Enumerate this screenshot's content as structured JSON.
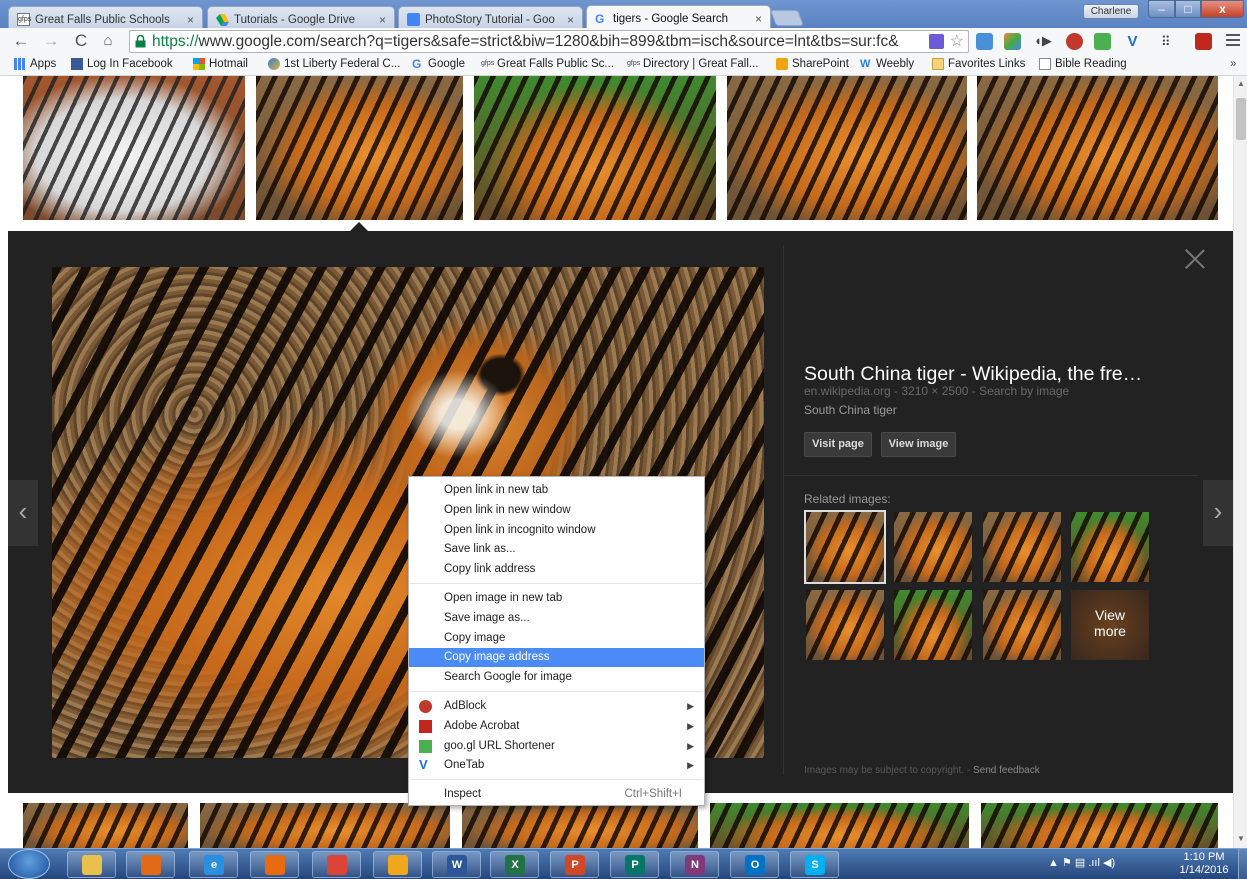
{
  "browser": {
    "tabs": [
      {
        "label": "Great Falls Public Schools",
        "close": "×",
        "favicon": "gfps-icon",
        "active": false
      },
      {
        "label": "Tutorials - Google Drive",
        "close": "×",
        "favicon": "google-drive-icon",
        "active": false
      },
      {
        "label": "PhotoStory Tutorial - Goo",
        "close": "×",
        "favicon": "google-docs-icon",
        "active": false
      },
      {
        "label": "tigers - Google Search",
        "close": "×",
        "favicon": "google-icon",
        "active": true
      }
    ],
    "user_name": "Charlene",
    "window_buttons": {
      "minimize": "–",
      "maximize": "□",
      "close": "x"
    },
    "url": {
      "scheme": "https://",
      "rest": "www.google.com/search?q=tigers&safe=strict&biw=1280&bih=899&tbm=isch&source=lnt&tbs=sur:fc&"
    },
    "bookmarks": [
      {
        "label": "Apps",
        "icon": "apps-grid-icon"
      },
      {
        "label": "Log In Facebook",
        "icon": "facebook-icon"
      },
      {
        "label": "Hotmail",
        "icon": "windows-logo-icon"
      },
      {
        "label": "1st Liberty Federal C...",
        "icon": "liberty-icon"
      },
      {
        "label": "Google",
        "icon": "google-icon"
      },
      {
        "label": "Great Falls Public Sc...",
        "icon": "gfps-icon"
      },
      {
        "label": "Directory | Great Fall...",
        "icon": "gfps-icon"
      },
      {
        "label": "SharePoint",
        "icon": "sharepoint-icon"
      },
      {
        "label": "Weebly",
        "icon": "weebly-icon"
      },
      {
        "label": "Favorites Links",
        "icon": "folder-icon"
      },
      {
        "label": "Bible Reading",
        "icon": "page-icon"
      }
    ],
    "bookmarks_more": "»"
  },
  "detail": {
    "title": "South China tiger - Wikipedia, the fre…",
    "meta": "en.wikipedia.org - 3210 × 2500 - Search by image",
    "description": "South China tiger",
    "visit_label": "Visit page",
    "view_label": "View image",
    "related_label": "Related images:",
    "view_more_label": "View\nmore",
    "copyright_text": "Images may be subject to copyright.",
    "copyright_sep": " - ",
    "feedback_label": "Send feedback"
  },
  "context_menu": {
    "group1": [
      "Open link in new tab",
      "Open link in new window",
      "Open link in incognito window",
      "Save link as...",
      "Copy link address"
    ],
    "group2": [
      "Open image in new tab",
      "Save image as...",
      "Copy image",
      "Copy image address",
      "Search Google for image"
    ],
    "highlighted": "Copy image address",
    "extensions": [
      {
        "label": "AdBlock",
        "icon": "adblock-icon",
        "color": "#c0392b"
      },
      {
        "label": "Adobe Acrobat",
        "icon": "acrobat-icon",
        "color": "#c0271d"
      },
      {
        "label": "goo.gl URL Shortener",
        "icon": "googl-shortener-icon",
        "color": "#4caf50"
      },
      {
        "label": "OneTab",
        "icon": "onetab-icon",
        "color": "#1e6fd0"
      }
    ],
    "submenu_arrow": "▶",
    "inspect_label": "Inspect",
    "inspect_shortcut": "Ctrl+Shift+I"
  },
  "taskbar": {
    "apps": [
      {
        "name": "file-explorer-icon",
        "letter": "",
        "color": "#e8c04b"
      },
      {
        "name": "media-player-icon",
        "letter": "",
        "color": "#e06a16"
      },
      {
        "name": "internet-explorer-icon",
        "letter": "e",
        "color": "#2b8fe0"
      },
      {
        "name": "firefox-icon",
        "letter": "",
        "color": "#e86b12"
      },
      {
        "name": "chrome-icon",
        "letter": "",
        "color": "#db4437"
      },
      {
        "name": "windows-apps-icon",
        "letter": "",
        "color": "#f2a81d"
      },
      {
        "name": "word-icon",
        "letter": "W",
        "color": "#2b579a"
      },
      {
        "name": "excel-icon",
        "letter": "X",
        "color": "#217346"
      },
      {
        "name": "powerpoint-icon",
        "letter": "P",
        "color": "#d24726"
      },
      {
        "name": "publisher-icon",
        "letter": "P",
        "color": "#077568"
      },
      {
        "name": "onenote-icon",
        "letter": "N",
        "color": "#80397b"
      },
      {
        "name": "outlook-icon",
        "letter": "O",
        "color": "#0072c6"
      },
      {
        "name": "skype-icon",
        "letter": "S",
        "color": "#00aff0"
      }
    ],
    "tray": "▲  ⚑  ▤  .ııl  ◀)",
    "time": "1:10 PM",
    "date": "1/14/2016"
  },
  "nav": {
    "prev": "‹",
    "next": "›"
  },
  "colors": {
    "highlight": "#4b8bf5",
    "panel_bg": "#222222",
    "https_green": "#0b8043"
  }
}
